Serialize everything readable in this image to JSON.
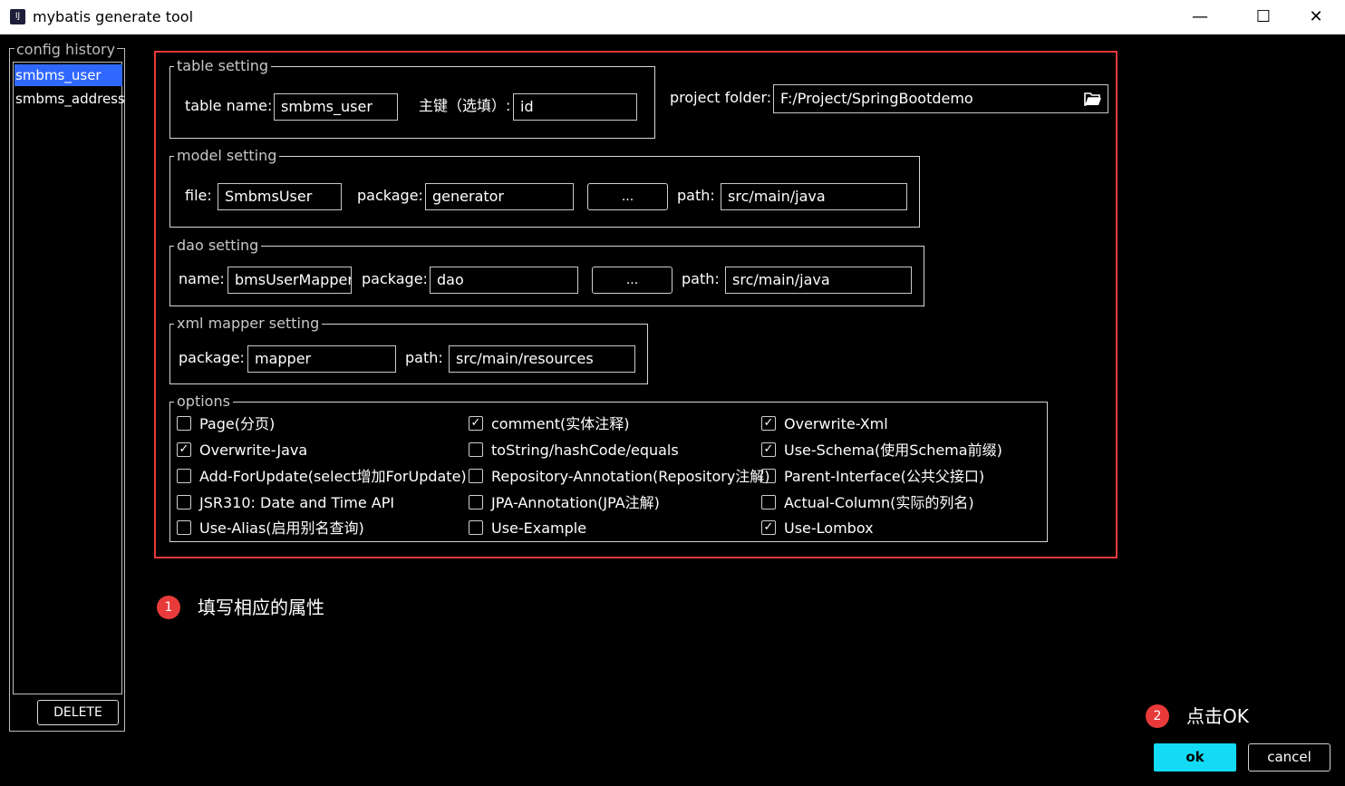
{
  "window": {
    "icon_text": "IJ",
    "title": "mybatis generate tool",
    "minimize": "—",
    "maximize": "☐",
    "close": "✕"
  },
  "history": {
    "title": "config history",
    "items": [
      "smbms_user",
      "smbms_address"
    ],
    "selected_index": 0,
    "delete_label": "DELETE"
  },
  "table_setting": {
    "legend": "table setting",
    "table_name_label": "table  name:",
    "table_name": "smbms_user",
    "pk_label": "主键（选填）:",
    "pk_value": "id"
  },
  "project": {
    "folder_label": "project folder:",
    "folder_value": "F:/Project/SpringBootdemo",
    "folder_icon": "folder-open-icon"
  },
  "model_setting": {
    "legend": "model setting",
    "file_label": "file:",
    "file_value": "SmbmsUser",
    "package_label": "package:",
    "package_value": "generator",
    "browse_label": "...",
    "path_label": "path:",
    "path_value": "src/main/java"
  },
  "dao_setting": {
    "legend": "dao setting",
    "name_label": "name:",
    "name_value": "bmsUserMapper",
    "package_label": "package:",
    "package_value": "dao",
    "browse_label": "...",
    "path_label": "path:",
    "path_value": "src/main/java"
  },
  "xml_setting": {
    "legend": "xml mapper setting",
    "package_label": "package:",
    "package_value": "mapper",
    "path_label": "path:",
    "path_value": "src/main/resources"
  },
  "options": {
    "legend": "options",
    "check_glyph": "✓",
    "items": [
      {
        "label": "Page(分页)",
        "checked": false
      },
      {
        "label": "comment(实体注释)",
        "checked": true
      },
      {
        "label": "Overwrite-Xml",
        "checked": true
      },
      {
        "label": "Overwrite-Java",
        "checked": true
      },
      {
        "label": "toString/hashCode/equals",
        "checked": false
      },
      {
        "label": "Use-Schema(使用Schema前缀)",
        "checked": true
      },
      {
        "label": "Add-ForUpdate(select增加ForUpdate)",
        "checked": false
      },
      {
        "label": "Repository-Annotation(Repository注解)",
        "checked": false
      },
      {
        "label": "Parent-Interface(公共父接口)",
        "checked": false
      },
      {
        "label": "JSR310: Date and Time API",
        "checked": false
      },
      {
        "label": "JPA-Annotation(JPA注解)",
        "checked": false
      },
      {
        "label": "Actual-Column(实际的列名)",
        "checked": false
      },
      {
        "label": "Use-Alias(启用别名查询)",
        "checked": false
      },
      {
        "label": "Use-Example",
        "checked": false
      },
      {
        "label": "Use-Lombox",
        "checked": true
      }
    ]
  },
  "callouts": [
    {
      "number": "1",
      "text": "填写相应的属性"
    },
    {
      "number": "2",
      "text": "点击OK"
    }
  ],
  "actions": {
    "ok_label": "ok",
    "cancel_label": "cancel"
  },
  "colors": {
    "highlight": "#e83a3a",
    "selection": "#2f68ff",
    "ok_button": "#13dbf5"
  }
}
